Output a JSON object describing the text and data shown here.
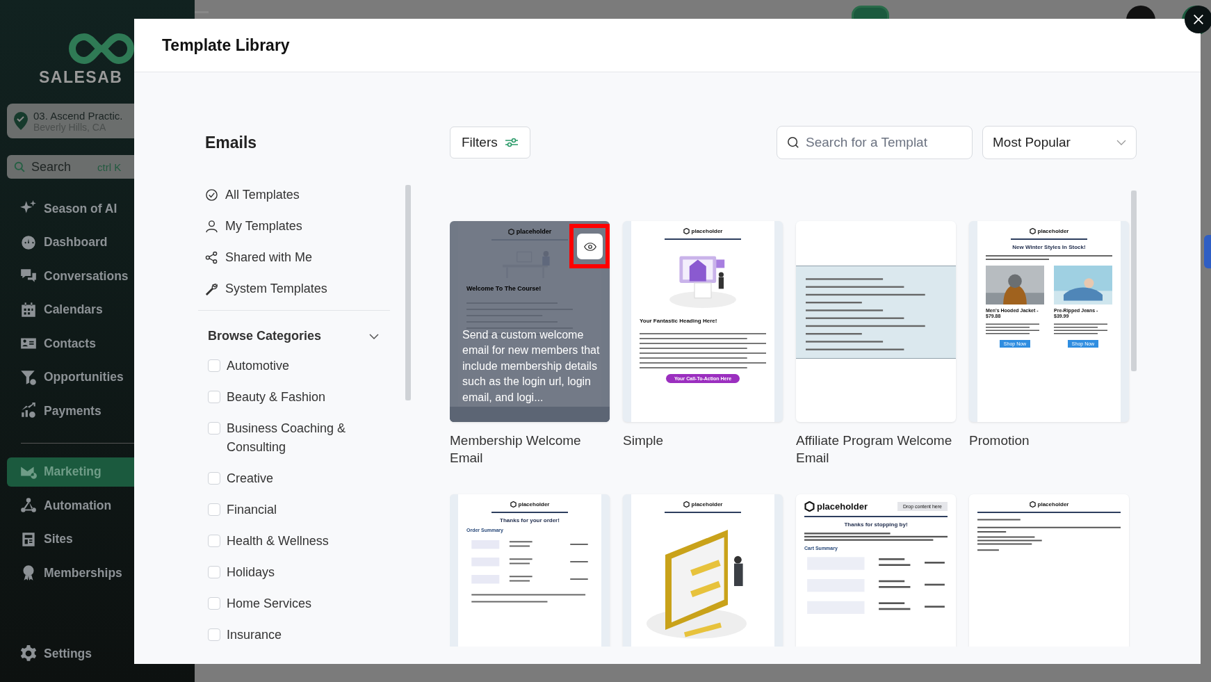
{
  "sidebar": {
    "brand": "SALESAB",
    "location": {
      "name": "03. Ascend Practic.",
      "city": "Beverly Hills, CA"
    },
    "search": {
      "label": "Search",
      "shortcut": "ctrl K"
    },
    "items": [
      {
        "label": "Season of AI",
        "selected": false
      },
      {
        "label": "Dashboard",
        "selected": false
      },
      {
        "label": "Conversations",
        "selected": false
      },
      {
        "label": "Calendars",
        "selected": false
      },
      {
        "label": "Contacts",
        "selected": false
      },
      {
        "label": "Opportunities",
        "selected": false
      },
      {
        "label": "Payments",
        "selected": false
      },
      {
        "label": "Marketing",
        "selected": true
      },
      {
        "label": "Automation",
        "selected": false
      },
      {
        "label": "Sites",
        "selected": false
      },
      {
        "label": "Memberships",
        "selected": false
      }
    ],
    "settings": "Settings"
  },
  "modal": {
    "title": "Template Library",
    "section": "Emails",
    "filters_button": "Filters",
    "search": {
      "placeholder": "Search for a Templat"
    },
    "sort": {
      "value": "Most Popular"
    },
    "nav": [
      {
        "label": "All Templates"
      },
      {
        "label": "My Templates"
      },
      {
        "label": "Shared with Me"
      },
      {
        "label": "System Templates"
      }
    ],
    "categories": {
      "title": "Browse Categories",
      "expanded": true,
      "items": [
        {
          "label": "Automotive",
          "checked": false
        },
        {
          "label": "Beauty & Fashion",
          "checked": false
        },
        {
          "label": "Business Coaching & Consulting",
          "checked": false
        },
        {
          "label": "Creative",
          "checked": false
        },
        {
          "label": "Financial",
          "checked": false
        },
        {
          "label": "Health & Wellness",
          "checked": false
        },
        {
          "label": "Holidays",
          "checked": false
        },
        {
          "label": "Home Services",
          "checked": false
        },
        {
          "label": "Insurance",
          "checked": false
        }
      ]
    },
    "cards": [
      {
        "title": "Membership Welcome Email",
        "kind": "membership",
        "hovered": true,
        "annotated": true,
        "logo": "placeholder",
        "heading": "Welcome To The Course!",
        "description": "Send a custom welcome email for new members that include membership details such as the login url, login email, and logi..."
      },
      {
        "title": "Simple",
        "kind": "simple",
        "hovered": false,
        "logo": "placeholder",
        "heading": "Your Fantastic Heading Here!",
        "cta": "Your Call-To-Action Here"
      },
      {
        "title": "Affiliate Program Welcome Email",
        "kind": "affiliate",
        "hovered": false
      },
      {
        "title": "Promotion",
        "kind": "promotion",
        "hovered": false,
        "logo": "placeholder",
        "heading": "New Winter Styles In Stock!",
        "products": [
          {
            "name": "Men's Hooded Jacket - $79.88",
            "button": "Shop Now"
          },
          {
            "name": "Pre-Ripped Jeans - $39.99",
            "button": "Shop Now"
          }
        ]
      },
      {
        "kind": "order",
        "hovered": false,
        "logo": "placeholder",
        "heading": "Thanks for your order!",
        "subheading": "Order Summary"
      },
      {
        "kind": "illustration",
        "hovered": false,
        "logo": "placeholder"
      },
      {
        "kind": "cart",
        "hovered": false,
        "logo": "placeholder",
        "heading": "Thanks for stopping by!",
        "subheading": "Cart Summary",
        "drop": "Drop content here"
      },
      {
        "kind": "plain",
        "hovered": false,
        "logo": "placeholder"
      }
    ]
  }
}
